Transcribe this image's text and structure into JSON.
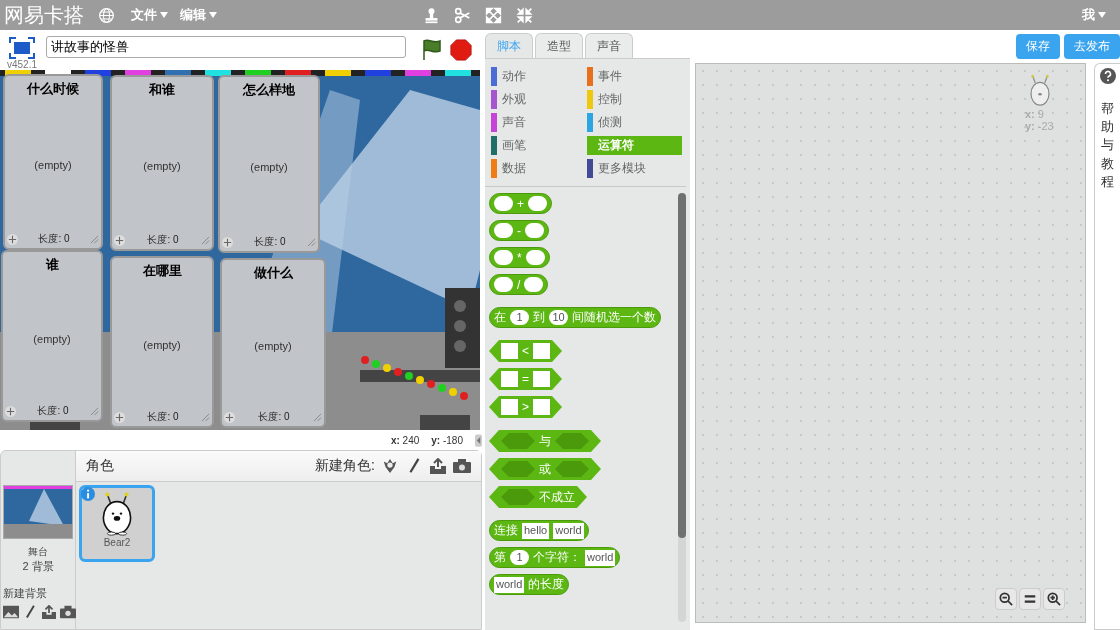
{
  "menu_bar": {
    "logo": "网易卡搭",
    "menus": [
      "文件",
      "编辑"
    ],
    "account": "我"
  },
  "stage_header": {
    "project_title": "讲故事的怪兽",
    "version": "v452.1"
  },
  "list_monitors": [
    {
      "title": "什么时候",
      "content": "(empty)",
      "length_label": "长度: 0"
    },
    {
      "title": "和谁",
      "content": "(empty)",
      "length_label": "长度: 0"
    },
    {
      "title": "怎么样地",
      "content": "(empty)",
      "length_label": "长度: 0"
    },
    {
      "title": "谁",
      "content": "(empty)",
      "length_label": "长度: 0"
    },
    {
      "title": "在哪里",
      "content": "(empty)",
      "length_label": "长度: 0"
    },
    {
      "title": "做什么",
      "content": "(empty)",
      "length_label": "长度: 0"
    }
  ],
  "stage_coords": {
    "x": "**x:** 240",
    "y": "**y:** -180"
  },
  "sprite_pane": {
    "header": "角色",
    "new_sprite_label": "新建角色:",
    "stage_label": "舞台",
    "backdrop_count": "2 背景",
    "new_backdrop_label": "新建背景",
    "sprites": [
      {
        "name": "Bear2",
        "selected": true
      }
    ]
  },
  "tabs": [
    {
      "label": "脚本",
      "selected": true
    },
    {
      "label": "造型",
      "selected": false
    },
    {
      "label": "声音",
      "selected": false
    }
  ],
  "categories": [
    {
      "label": "动作",
      "color": "#4a6cd4",
      "selected": false
    },
    {
      "label": "事件",
      "color": "#e6701e",
      "selected": false
    },
    {
      "label": "外观",
      "color": "#a856d0",
      "selected": false
    },
    {
      "label": "控制",
      "color": "#edc80f",
      "selected": false
    },
    {
      "label": "声音",
      "color": "#c643d8",
      "selected": false
    },
    {
      "label": "侦测",
      "color": "#2ca5e2",
      "selected": false
    },
    {
      "label": "画笔",
      "color": "#1f6e68",
      "selected": false
    },
    {
      "label": "运算符",
      "color": "#5cb712",
      "selected": true
    },
    {
      "label": "数据",
      "color": "#ee7d16",
      "selected": false
    },
    {
      "label": "更多模块",
      "color": "#424a96",
      "selected": false
    }
  ],
  "block_groups": [
    [
      {
        "kind": "reporter",
        "parts": [
          {
            "kind": "num"
          },
          {
            "kind": "label",
            "text": "+"
          },
          {
            "kind": "num"
          }
        ]
      },
      {
        "kind": "reporter",
        "parts": [
          {
            "kind": "num"
          },
          {
            "kind": "label",
            "text": "-"
          },
          {
            "kind": "num"
          }
        ]
      },
      {
        "kind": "reporter",
        "parts": [
          {
            "kind": "num"
          },
          {
            "kind": "label",
            "text": "*"
          },
          {
            "kind": "num"
          }
        ]
      },
      {
        "kind": "reporter",
        "parts": [
          {
            "kind": "num"
          },
          {
            "kind": "label",
            "text": "/"
          },
          {
            "kind": "num"
          }
        ]
      }
    ],
    [
      {
        "kind": "reporter",
        "parts": [
          {
            "kind": "label",
            "text": "在"
          },
          {
            "kind": "num",
            "text": "1"
          },
          {
            "kind": "label",
            "text": "到"
          },
          {
            "kind": "num",
            "text": "10"
          },
          {
            "kind": "label",
            "text": "间随机选一个数"
          }
        ]
      }
    ],
    [
      {
        "kind": "boolean",
        "parts": [
          {
            "kind": "str"
          },
          {
            "kind": "label",
            "text": "<"
          },
          {
            "kind": "str"
          }
        ]
      },
      {
        "kind": "boolean",
        "parts": [
          {
            "kind": "str"
          },
          {
            "kind": "label",
            "text": "="
          },
          {
            "kind": "str"
          }
        ]
      },
      {
        "kind": "boolean",
        "parts": [
          {
            "kind": "str"
          },
          {
            "kind": "label",
            "text": ">"
          },
          {
            "kind": "str"
          }
        ]
      }
    ],
    [
      {
        "kind": "boolean",
        "parts": [
          {
            "kind": "bool"
          },
          {
            "kind": "label",
            "text": "与"
          },
          {
            "kind": "bool"
          }
        ]
      },
      {
        "kind": "boolean",
        "parts": [
          {
            "kind": "bool"
          },
          {
            "kind": "label",
            "text": "或"
          },
          {
            "kind": "bool"
          }
        ]
      },
      {
        "kind": "boolean",
        "parts": [
          {
            "kind": "bool"
          },
          {
            "kind": "label",
            "text": "不成立"
          }
        ]
      }
    ],
    [
      {
        "kind": "reporter",
        "parts": [
          {
            "kind": "label",
            "text": "连接"
          },
          {
            "kind": "str",
            "text": "hello"
          },
          {
            "kind": "str",
            "text": "world"
          }
        ]
      },
      {
        "kind": "reporter",
        "parts": [
          {
            "kind": "label",
            "text": "第"
          },
          {
            "kind": "num",
            "text": "1"
          },
          {
            "kind": "label",
            "text": "个字符："
          },
          {
            "kind": "str",
            "text": "world"
          }
        ]
      },
      {
        "kind": "reporter",
        "parts": [
          {
            "kind": "str",
            "text": "world"
          },
          {
            "kind": "label",
            "text": "的长度"
          }
        ]
      }
    ]
  ],
  "buttons": [
    "保存",
    "去发布"
  ],
  "script_area": {
    "sprite_x": "**x:** 9",
    "sprite_y": "**y:** -23"
  },
  "help_panel": {
    "label": "帮助与教程"
  }
}
